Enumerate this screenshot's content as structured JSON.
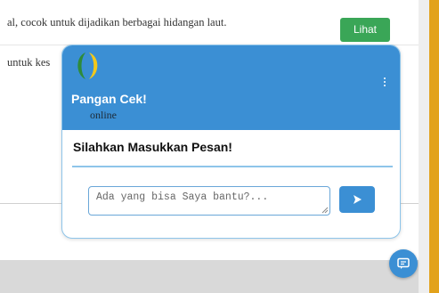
{
  "background": {
    "rows": [
      {
        "text": "al, cocok untuk dijadikan berbagai hidangan laut."
      },
      {
        "text": "untuk kes"
      }
    ],
    "view_button_label": "Lihat"
  },
  "chat": {
    "title": "Pangan Cek!",
    "status": "online",
    "prompt": "Silahkan Masukkan Pesan!",
    "input_placeholder": "Ada yang bisa Saya bantu?...",
    "icons": {
      "logo": "leaf-logo-icon",
      "menu": "kebab-menu-icon",
      "send": "send-icon",
      "fab": "chat-bubble-icon"
    }
  },
  "colors": {
    "header": "#3b8fd4",
    "accent": "#e2a21b",
    "view_button": "#3aa657"
  }
}
